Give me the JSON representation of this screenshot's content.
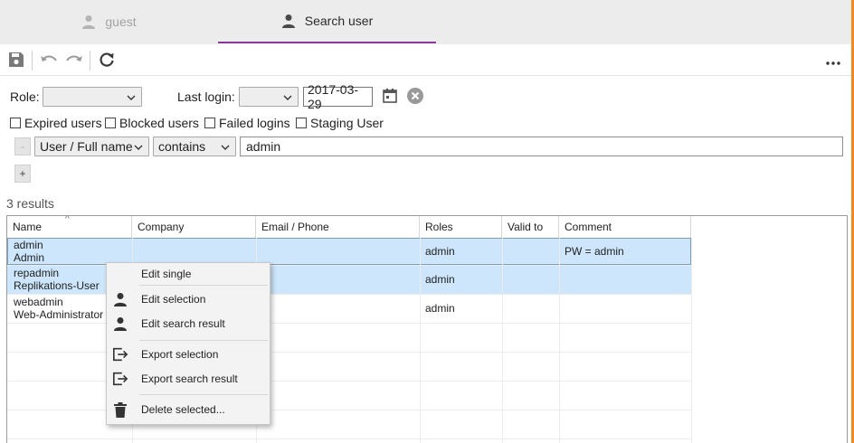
{
  "tabs": [
    {
      "label": "guest",
      "icon": "user-icon",
      "active": false
    },
    {
      "label": "Search user",
      "icon": "user-icon",
      "active": true
    }
  ],
  "toolbar": {
    "icons": [
      "save-icon",
      "undo-icon",
      "redo-icon",
      "refresh-icon",
      "more-icon"
    ]
  },
  "filters": {
    "role_label": "Role:",
    "role_value": "",
    "last_login_label": "Last login:",
    "last_login_value": "",
    "date_value": "2017-03-29",
    "checkboxes": [
      {
        "label": "Expired users",
        "checked": false
      },
      {
        "label": "Blocked users",
        "checked": false
      },
      {
        "label": "Failed logins",
        "checked": false
      },
      {
        "label": "Staging User",
        "checked": false
      }
    ],
    "remove_label": "-",
    "field_value": "User / Full name",
    "operator_value": "contains",
    "search_value": "admin",
    "add_label": "+"
  },
  "results": {
    "count_text": "3 results",
    "columns": [
      "Name",
      "Company",
      "Email / Phone",
      "Roles",
      "Valid to",
      "Comment"
    ],
    "rows": [
      {
        "name": "admin",
        "fullname": "Admin",
        "company": "",
        "email": "",
        "roles": "admin",
        "valid_to": "",
        "comment": "PW = admin",
        "selected": true
      },
      {
        "name": "repadmin",
        "fullname": "Replikations-User",
        "company": "",
        "email": "",
        "roles": "admin",
        "valid_to": "",
        "comment": "",
        "selected": true
      },
      {
        "name": "webadmin",
        "fullname": "Web-Administrator",
        "company": "",
        "email": "",
        "roles": "admin",
        "valid_to": "",
        "comment": "",
        "selected": false
      }
    ]
  },
  "context_menu": {
    "items": [
      {
        "label": "Edit single",
        "icon": ""
      },
      {
        "label": "Edit selection",
        "icon": "user-icon"
      },
      {
        "label": "Edit search result",
        "icon": "user-icon"
      },
      {
        "label": "Export selection",
        "icon": "export-icon"
      },
      {
        "label": "Export search result",
        "icon": "export-icon"
      },
      {
        "label": "Delete selected...",
        "icon": "trash-icon"
      }
    ]
  },
  "colors": {
    "accent": "#8b3a9c",
    "selection": "#cde6fb",
    "scroll_accent": "#f08a20"
  }
}
